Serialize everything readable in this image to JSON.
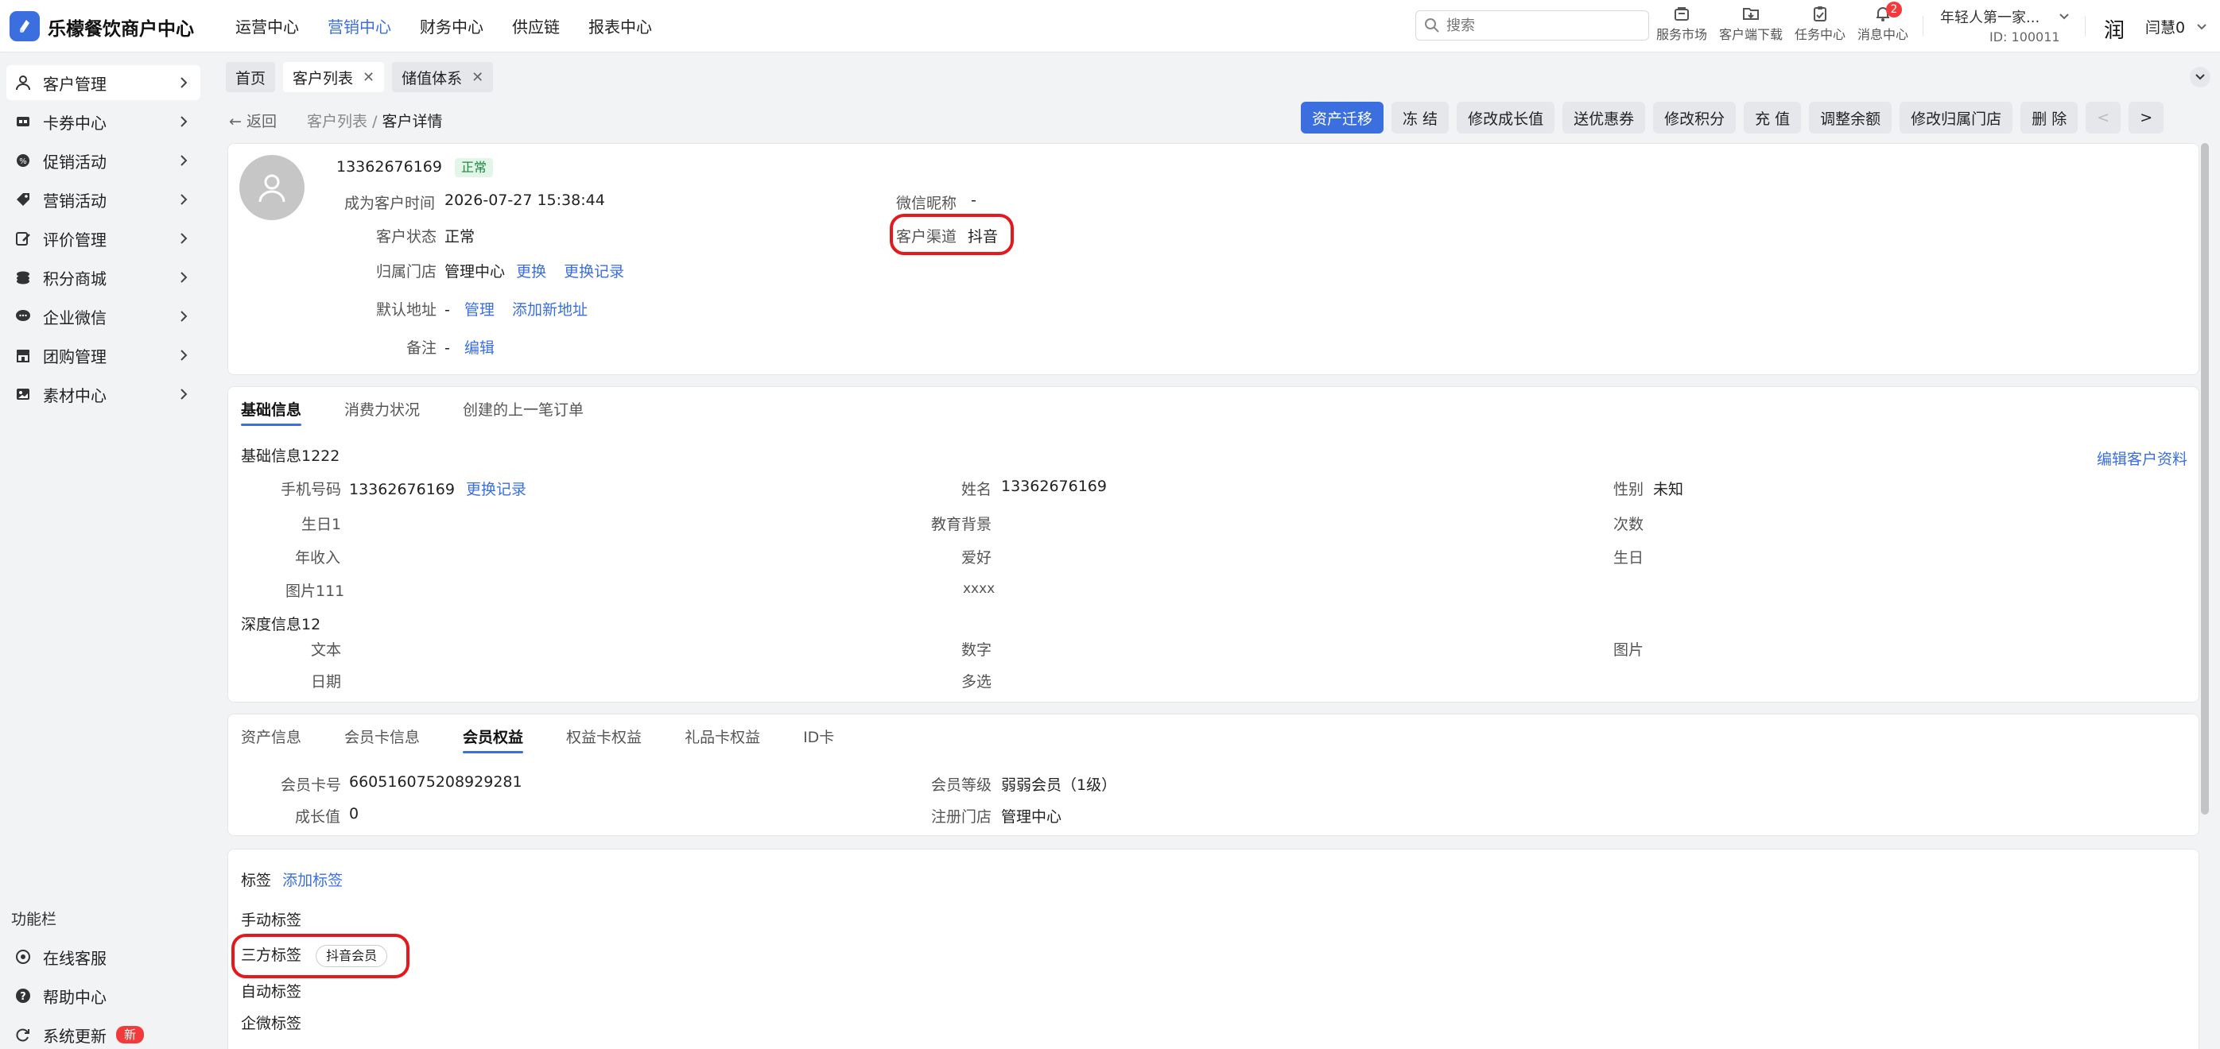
{
  "app": {
    "title": "乐檬餐饮商户中心",
    "nav": [
      "运营中心",
      "营销中心",
      "财务中心",
      "供应链",
      "报表中心"
    ],
    "active_nav": "营销中心",
    "search_placeholder": "搜索",
    "tools": {
      "service_market": "服务市场",
      "client_download": "客户端下载",
      "task_center": "任务中心",
      "message_center": "消息中心",
      "message_count": "2"
    },
    "account": {
      "name": "年轻人第一家...",
      "id": "ID: 100011"
    },
    "user": {
      "avatar_text": "润",
      "name": "闫慧0"
    }
  },
  "sidebar": {
    "items": [
      {
        "label": "客户管理",
        "icon": "user-icon"
      },
      {
        "label": "卡券中心",
        "icon": "card-icon"
      },
      {
        "label": "促销活动",
        "icon": "gear-badge-icon"
      },
      {
        "label": "营销活动",
        "icon": "tag-icon"
      },
      {
        "label": "评价管理",
        "icon": "edit-icon"
      },
      {
        "label": "积分商城",
        "icon": "coins-icon"
      },
      {
        "label": "企业微信",
        "icon": "chat-icon"
      },
      {
        "label": "团购管理",
        "icon": "store-icon"
      },
      {
        "label": "素材中心",
        "icon": "image-icon"
      }
    ],
    "section_title": "功能栏",
    "bottom": [
      {
        "label": "在线客服",
        "icon": "headset-icon"
      },
      {
        "label": "帮助中心",
        "icon": "help-icon"
      },
      {
        "label": "系统更新",
        "icon": "refresh-icon",
        "badge": "新"
      }
    ]
  },
  "tabs": [
    {
      "label": "首页",
      "closable": false
    },
    {
      "label": "客户列表",
      "closable": true
    },
    {
      "label": "储值体系",
      "closable": true
    }
  ],
  "breadcrumb": {
    "back": "返回",
    "parent": "客户列表",
    "current": "客户详情"
  },
  "actions": [
    "资产迁移",
    "冻 结",
    "修改成长值",
    "送优惠券",
    "修改积分",
    "充 值",
    "调整余额",
    "修改归属门店",
    "删 除"
  ],
  "profile": {
    "phone": "13362676169",
    "status_tag": "正常",
    "became_customer_label": "成为客户时间",
    "became_customer_value": "2026-07-27 15:38:44",
    "status_label": "客户状态",
    "status_value": "正常",
    "store_label": "归属门店",
    "store_value": "管理中心",
    "store_change": "更换",
    "store_history": "更换记录",
    "address_label": "默认地址",
    "address_value": "-",
    "address_manage": "管理",
    "address_add": "添加新地址",
    "remark_label": "备注",
    "remark_value": "-",
    "remark_edit": "编辑",
    "wechat_label": "微信昵称",
    "wechat_value": "-",
    "channel_label": "客户渠道",
    "channel_value": "抖音"
  },
  "basic": {
    "tabs": [
      "基础信息",
      "消费力状况",
      "创建的上一笔订单"
    ],
    "section1": "基础信息1222",
    "edit_link": "编辑客户资料",
    "phone_label": "手机号码",
    "phone_value": "13362676169",
    "phone_history": "更换记录",
    "name_label": "姓名",
    "name_value": "13362676169",
    "gender_label": "性别",
    "gender_value": "未知",
    "birthday1_label": "生日1",
    "education_label": "教育背景",
    "count_label": "次数",
    "income_label": "年收入",
    "hobby_label": "爱好",
    "birthday_label": "生日",
    "picture111_label": "图片111",
    "xxxx_label": "xxxx",
    "section2": "深度信息12",
    "text_label": "文本",
    "number_label": "数字",
    "image_label": "图片",
    "date_label": "日期",
    "multi_label": "多选"
  },
  "member": {
    "tabs": [
      "资产信息",
      "会员卡信息",
      "会员权益",
      "权益卡权益",
      "礼品卡权益",
      "ID卡"
    ],
    "card_no_label": "会员卡号",
    "card_no_value": "660516075208929281",
    "level_label": "会员等级",
    "level_value": "弱弱会员（1级）",
    "growth_label": "成长值",
    "growth_value": "0",
    "reg_store_label": "注册门店",
    "reg_store_value": "管理中心"
  },
  "tags": {
    "title": "标签",
    "add": "添加标签",
    "manual": "手动标签",
    "third_party": "三方标签",
    "third_party_tag": "抖音会员",
    "auto": "自动标签",
    "wecom": "企微标签"
  },
  "colors": {
    "accent": "#3b6fe0",
    "highlight_ring": "#e5181e",
    "badge": "#f23a3a"
  }
}
